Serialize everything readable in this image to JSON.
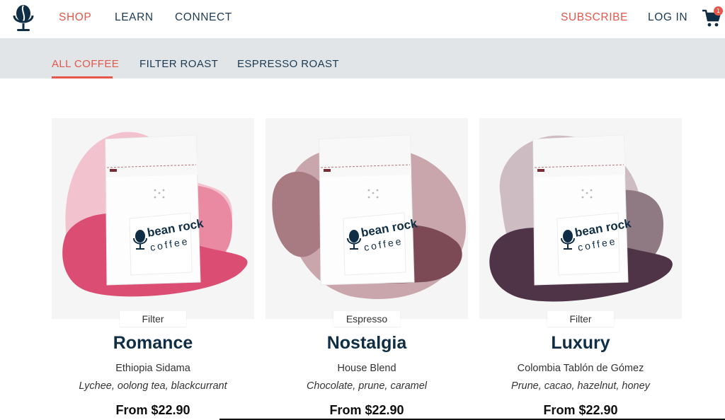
{
  "nav": {
    "shop": "SHOP",
    "learn": "LEARN",
    "connect": "CONNECT",
    "subscribe": "SUBSCRIBE",
    "login": "LOG IN",
    "cart_count": "1"
  },
  "filters": {
    "all": "ALL COFFEE",
    "filter": "FILTER ROAST",
    "espresso": "ESPRESSO ROAST"
  },
  "brand": {
    "bag_line1": "bean rock",
    "bag_line2": "coffee"
  },
  "colors": {
    "accent": "#e4574a",
    "navy": "#0f2e45",
    "filterbar": "#e1e5e8"
  },
  "products": [
    {
      "badge": "Filter",
      "name": "Romance",
      "origin": "Ethiopia Sidama",
      "notes": "Lychee, oolong tea, blackcurrant",
      "price": "From $22.90",
      "palette": [
        "#f2c3cf",
        "#e98aa2",
        "#dc4d74"
      ]
    },
    {
      "badge": "Espresso",
      "name": "Nostalgia",
      "origin": "House Blend",
      "notes": "Chocolate, prune, caramel",
      "price": "From $22.90",
      "palette": [
        "#c9a6ac",
        "#a87a82",
        "#7c4a55"
      ]
    },
    {
      "badge": "Filter",
      "name": "Luxury",
      "origin": "Colombia Tablón de Gómez",
      "notes": "Prune, cacao, hazelnut, honey",
      "price": "From $22.90",
      "palette": [
        "#cdbcc2",
        "#8f7a84",
        "#4e3446"
      ]
    }
  ]
}
